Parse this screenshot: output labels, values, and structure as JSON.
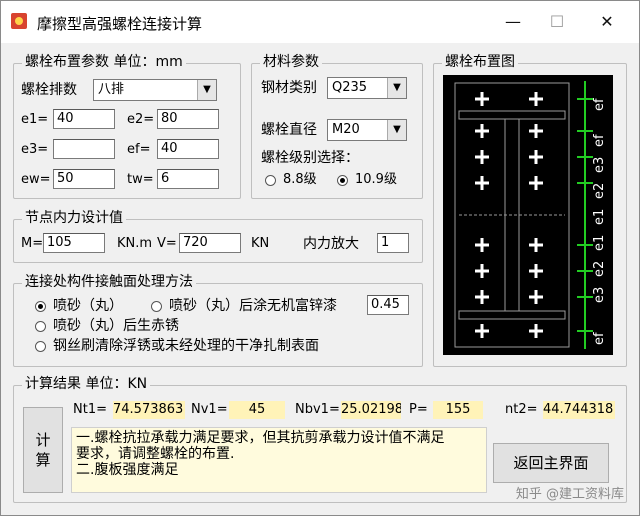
{
  "window": {
    "title": "摩擦型高强螺栓连接计算",
    "minimize": "—",
    "maximize": "☐",
    "close": "✕"
  },
  "layout_group": {
    "title": "螺栓布置参数 单位：mm",
    "rows_label": "螺栓排数",
    "rows_value": "八排",
    "e1_label": "e1=",
    "e1": "40",
    "e2_label": "e2=",
    "e2": "80",
    "e3_label": "e3=",
    "e3": "",
    "ef_label": "ef=",
    "ef": "40",
    "ew_label": "ew=",
    "ew": "50",
    "tw_label": "tw=",
    "tw": "6"
  },
  "material_group": {
    "title": "材料参数",
    "steel_label": "钢材类别",
    "steel_value": "Q235",
    "dia_label": "螺栓直径",
    "dia_value": "M20",
    "grade_label": "螺栓级别选择：",
    "grade_options": [
      "8.8级",
      "10.9级"
    ],
    "grade_selected": 1
  },
  "diagram_group": {
    "title": "螺栓布置图",
    "dim_labels": [
      "ef",
      "e3",
      "e2",
      "e1",
      "e1",
      "e2",
      "e3",
      "ef"
    ],
    "top_label": "ef"
  },
  "force_group": {
    "title": "节点内力设计值",
    "m_label": "M=",
    "m_value": "105",
    "m_unit": "KN.m",
    "v_label": "V=",
    "v_value": "720",
    "v_unit": "KN",
    "amp_label": "内力放大",
    "amp_value": "1"
  },
  "surface_group": {
    "title": "连接处构件接触面处理方法",
    "options": [
      "喷砂（丸）",
      "喷砂（丸）后涂无机富锌漆",
      "喷砂（丸）后生赤锈",
      "钢丝刷清除浮锈或未经处理的干净扎制表面"
    ],
    "selected": 0,
    "mu_value": "0.45"
  },
  "result_group": {
    "title": "计算结果 单位：KN",
    "calc_button": "计\n算",
    "nt1_label": "Nt1=",
    "nt1": "74.573863",
    "nv1_label": "Nv1=",
    "nv1": "45",
    "nbv1_label": "Nbv1=",
    "nbv1": "25.021980",
    "p_label": "P=",
    "p": "155",
    "nt2_label": "nt2=",
    "nt2": "44.744318",
    "message_line1": "一.螺栓抗拉承载力满足要求，但其抗剪承载力设计值不满足",
    "message_line2": "要求，请调整螺栓的布置.",
    "message_line3": "二.腹板强度满足",
    "back_button": "返回主界面"
  },
  "watermark": "知乎 @建工资料库"
}
